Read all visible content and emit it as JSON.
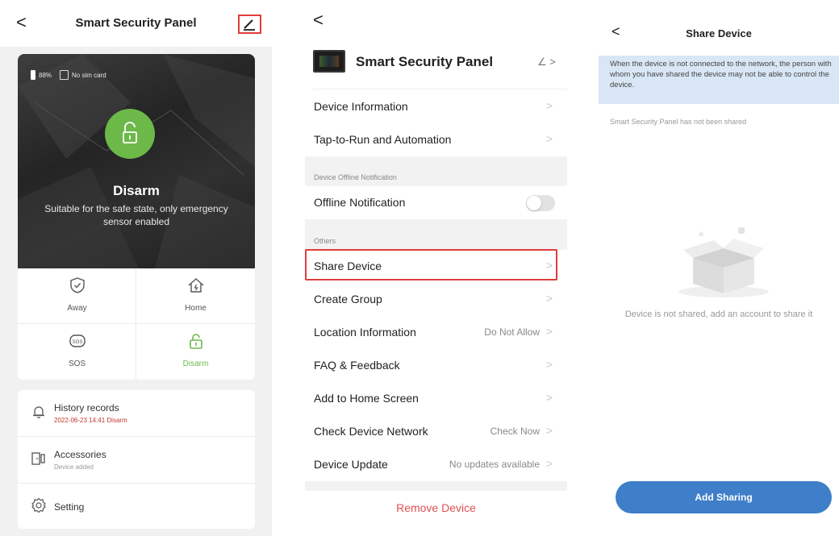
{
  "screen1": {
    "back_glyph": "<",
    "title": "Smart Security Panel",
    "edit_icon": "pencil-icon",
    "status": {
      "battery": "88%",
      "sim": "No sim card"
    },
    "current_mode": {
      "title": "Disarm",
      "description": "Suitable for the safe state, only emergency sensor enabled",
      "color": "#6cb94a"
    },
    "modes": [
      {
        "label": "Away",
        "icon": "shield-check-icon",
        "active": false
      },
      {
        "label": "Home",
        "icon": "home-icon",
        "active": false
      },
      {
        "label": "SOS",
        "icon": "sos-icon",
        "active": false
      },
      {
        "label": "Disarm",
        "icon": "unlock-icon",
        "active": true
      }
    ],
    "items": [
      {
        "title": "History records",
        "subtitle": "2022-06-23 14:41 Disarm",
        "icon": "bell-icon"
      },
      {
        "title": "Accessories",
        "subtitle": "Device added",
        "icon": "door-sensor-icon"
      },
      {
        "title": "Setting",
        "icon": "gear-icon"
      }
    ]
  },
  "screen2": {
    "back_glyph": "<",
    "device_name": "Smart Security Panel",
    "edit_glyph": "∠ >",
    "rows": {
      "device_info": "Device Information",
      "tap_to_run": "Tap-to-Run and Automation",
      "offline_section": "Device Offline Notification",
      "offline_notification": "Offline Notification",
      "others_section": "Others",
      "share_device": "Share Device",
      "create_group": "Create Group",
      "location": "Location Information",
      "location_value": "Do Not Allow",
      "faq": "FAQ & Feedback",
      "add_home": "Add to Home Screen",
      "check_network": "Check Device Network",
      "check_network_value": "Check Now",
      "device_update": "Device Update",
      "device_update_value": "No updates available"
    },
    "offline_toggle_on": false,
    "chevron": ">",
    "remove": "Remove Device"
  },
  "screen3": {
    "back_glyph": "<",
    "title": "Share Device",
    "notice": "When the device is not connected to the network, the person with whom you have shared the device may not be able to control the device.",
    "not_shared": "Smart Security Panel has not been shared",
    "empty_text": "Device is not shared, add an account to share it",
    "button": "Add Sharing",
    "accent": "#3f7ec9"
  }
}
